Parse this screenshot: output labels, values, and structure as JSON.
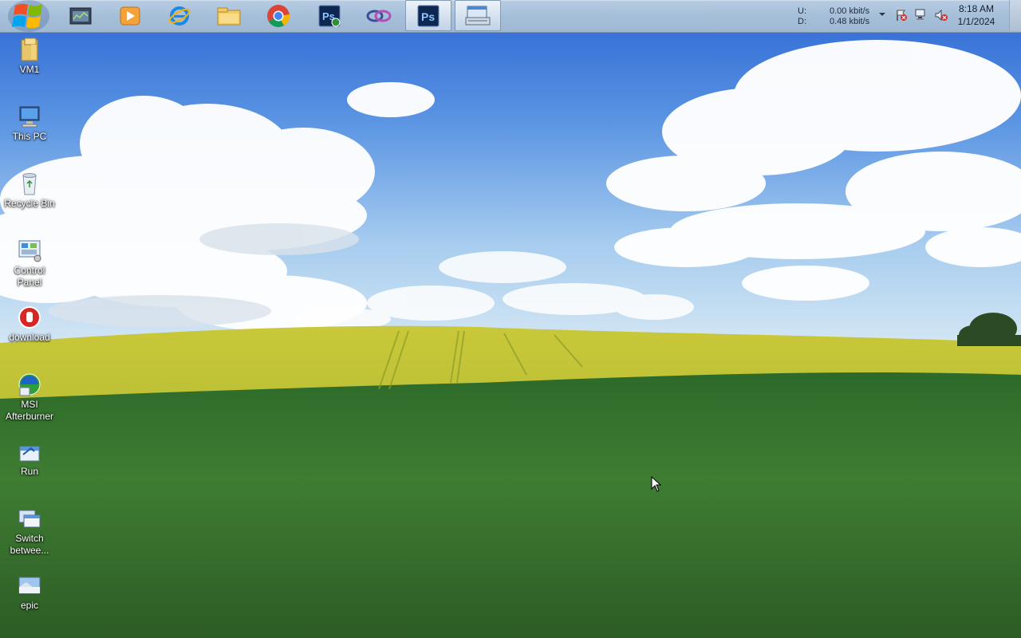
{
  "taskbar": {
    "pinned": [
      {
        "name": "task-manager-icon"
      },
      {
        "name": "media-player-icon"
      },
      {
        "name": "internet-explorer-icon"
      },
      {
        "name": "file-explorer-icon"
      },
      {
        "name": "chrome-icon"
      },
      {
        "name": "photoshop-alt-icon"
      },
      {
        "name": "link-rings-icon"
      },
      {
        "name": "photoshop-icon",
        "active": true
      },
      {
        "name": "on-screen-keyboard-icon",
        "active": true
      }
    ],
    "net_labels": {
      "up": "U:",
      "down": "D:"
    },
    "net_values": {
      "up": "0.00 kbit/s",
      "down": "0.48 kbit/s"
    },
    "clock": {
      "time": "8:18 AM",
      "date": "1/1/2024"
    }
  },
  "desktop_icons": [
    {
      "label": "VM1",
      "icon": "folder-icon"
    },
    {
      "label": "This PC",
      "icon": "computer-icon"
    },
    {
      "label": "Recycle Bin",
      "icon": "recycle-bin-icon"
    },
    {
      "label": "Control Panel",
      "icon": "control-panel-icon"
    },
    {
      "label": "download",
      "icon": "stop-hand-icon"
    },
    {
      "label": "MSI Afterburner",
      "icon": "msi-afterburner-icon"
    },
    {
      "label": "Run",
      "icon": "run-icon"
    },
    {
      "label": "Switch betwee...",
      "icon": "switch-windows-icon"
    },
    {
      "label": "epic",
      "icon": "image-file-icon"
    }
  ]
}
